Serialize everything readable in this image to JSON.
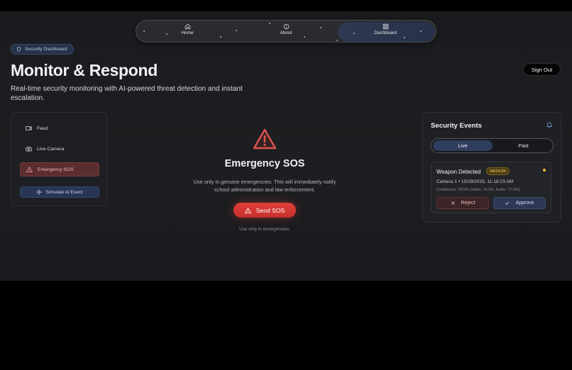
{
  "nav": {
    "items": [
      {
        "label": "Home",
        "icon": "home-icon"
      },
      {
        "label": "About",
        "icon": "info-icon"
      },
      {
        "label": "Dashboard",
        "icon": "grid-icon",
        "active": true
      }
    ]
  },
  "header": {
    "badge": "Security Dashboard",
    "title": "Monitor & Respond",
    "subtitle": "Real-time security monitoring with AI-powered threat detection and instant escalation.",
    "sign_out": "Sign Out"
  },
  "sidebar": {
    "items": [
      {
        "label": "Feed",
        "icon": "video-icon"
      },
      {
        "label": "Live Camera",
        "icon": "camera-icon"
      },
      {
        "label": "Emergency SOS",
        "icon": "warning-icon",
        "active": true
      }
    ],
    "simulate": "Simulate AI Event"
  },
  "sos": {
    "title": "Emergency SOS",
    "description": "Use only in genuine emergencies. This will immediately notify school administration and law enforcement.",
    "button": "Send SOS",
    "note": "Use only in emergencies."
  },
  "events": {
    "title": "Security Events",
    "tabs": {
      "live": "Live",
      "past": "Past",
      "active": "Live"
    },
    "items": [
      {
        "title": "Weapon Detected",
        "severity": "MEDIUM",
        "meta": "Camera 1 • 10/19/2025, 11:18:23 AM",
        "confidence": "Confidence: 78.0%  (Video: 74.2%, Audio: 77.4%)",
        "reject": "Reject",
        "approve": "Approve"
      }
    ]
  },
  "colors": {
    "accent_red": "#e0403a",
    "accent_blue": "#2f3d5e",
    "warning_yellow": "#f2c23a",
    "background": "#1c1d20"
  }
}
